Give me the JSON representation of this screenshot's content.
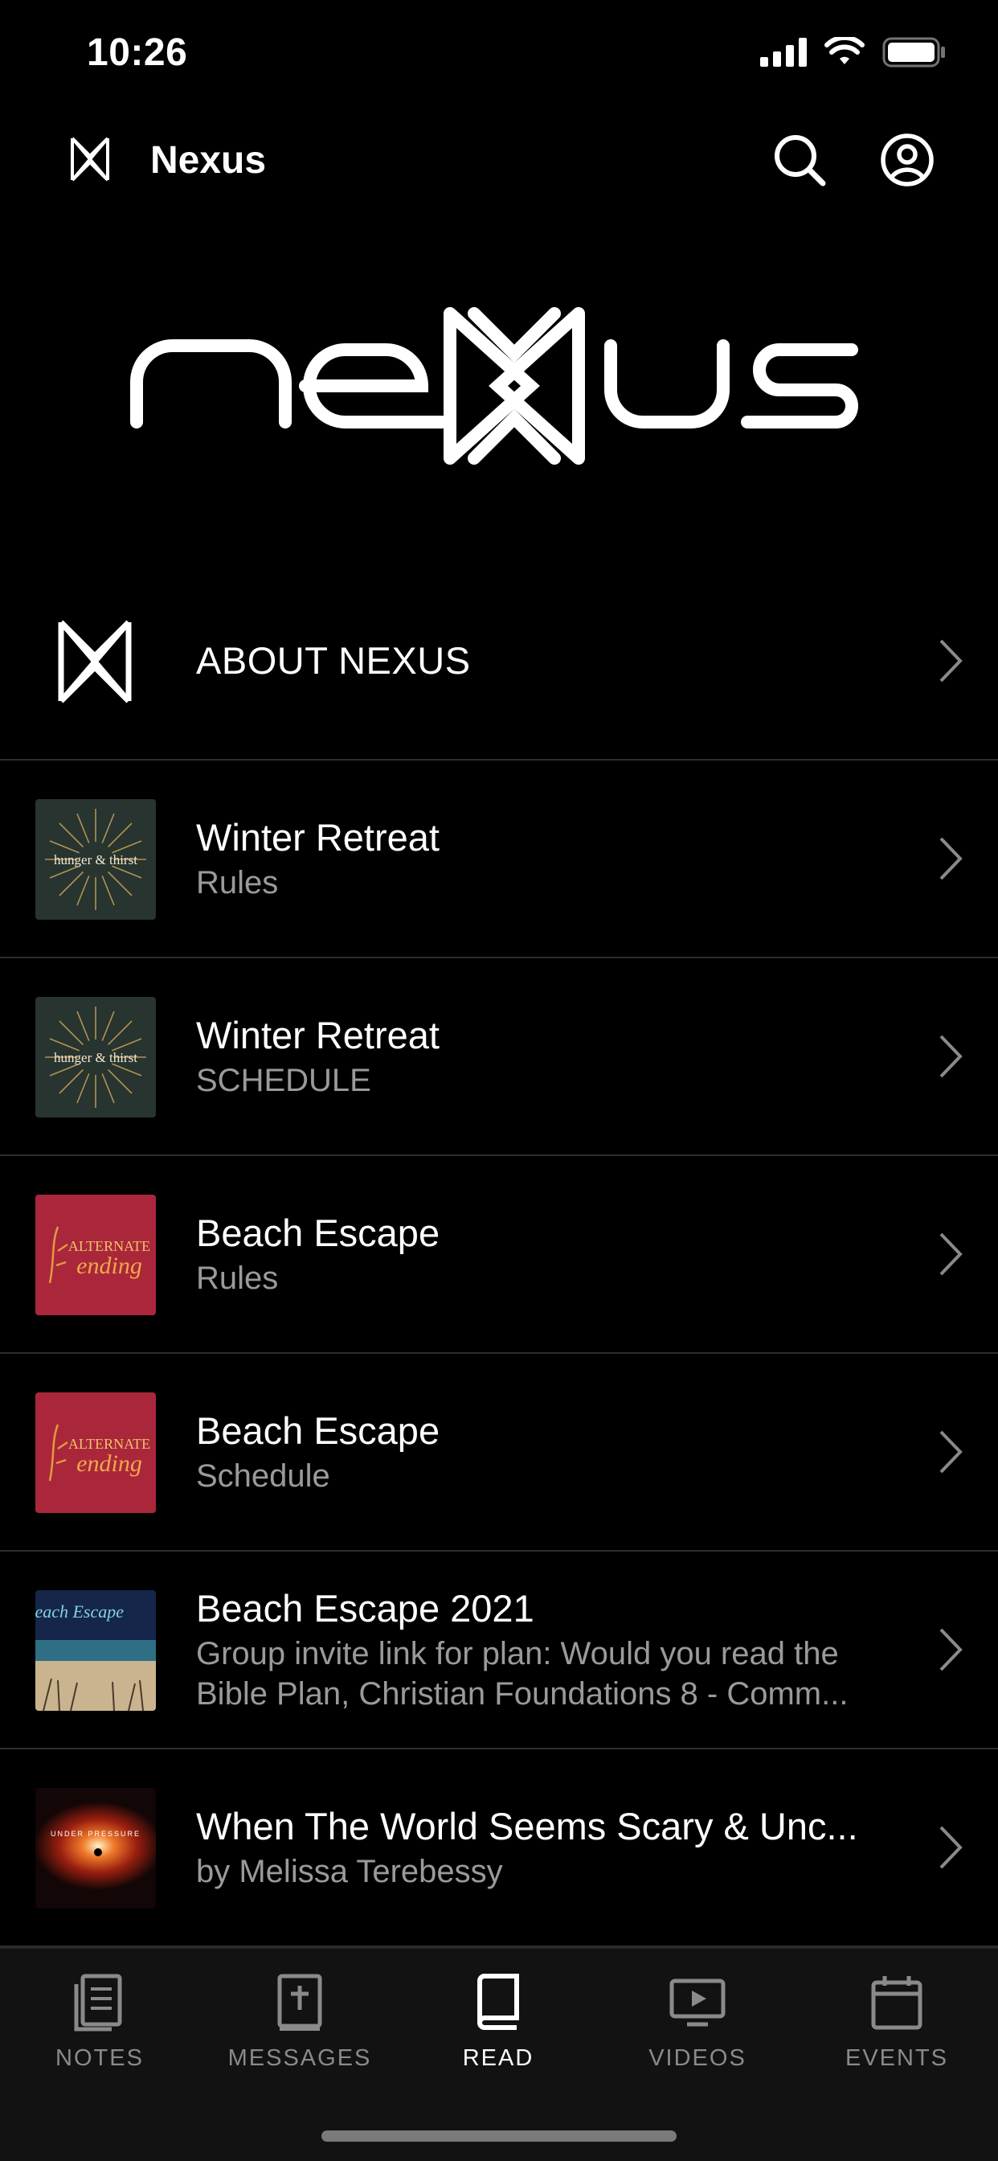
{
  "status_bar": {
    "time": "10:26"
  },
  "header": {
    "title": "Nexus"
  },
  "list": {
    "about": {
      "label": "ABOUT NEXUS"
    },
    "items": [
      {
        "title": "Winter Retreat",
        "subtitle": "Rules",
        "thumb": "hunger-thirst"
      },
      {
        "title": "Winter Retreat",
        "subtitle": "SCHEDULE",
        "thumb": "hunger-thirst"
      },
      {
        "title": "Beach Escape",
        "subtitle": "Rules",
        "thumb": "alternate-ending"
      },
      {
        "title": "Beach Escape",
        "subtitle": "Schedule",
        "thumb": "alternate-ending"
      },
      {
        "title": "Beach Escape 2021",
        "subtitle": "Group invite link for plan: Would you read the Bible Plan, Christian Foundations 8 - Comm...",
        "thumb": "beach-escape"
      },
      {
        "title": "When The World Seems Scary & Unc...",
        "subtitle": "by Melissa Terebessy",
        "thumb": "under-pressure"
      }
    ]
  },
  "thumbs": {
    "hunger_thirst": "hunger & thirst",
    "alternate_ending_1": "ALTERNATE",
    "alternate_ending_2": "ending",
    "beach_escape": "Beach Escape",
    "under_pressure": "UNDER PRESSURE"
  },
  "tabs": [
    {
      "label": "NOTES",
      "icon": "notes-icon"
    },
    {
      "label": "MESSAGES",
      "icon": "bible-icon"
    },
    {
      "label": "READ",
      "icon": "book-icon",
      "active": true
    },
    {
      "label": "VIDEOS",
      "icon": "video-icon"
    },
    {
      "label": "EVENTS",
      "icon": "calendar-icon"
    }
  ]
}
